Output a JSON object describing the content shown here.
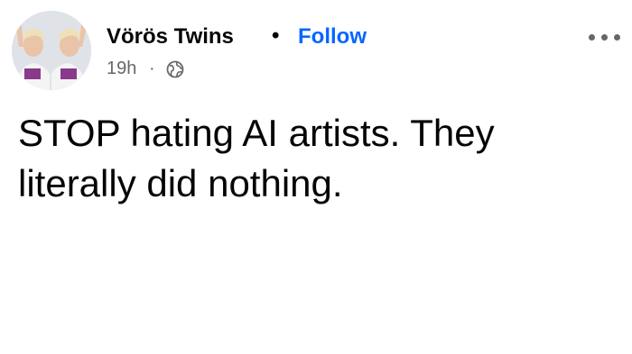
{
  "post": {
    "author": "Vörös Twins",
    "separator": "•",
    "follow_label": "Follow",
    "time": "19h",
    "meta_separator": "·",
    "privacy_icon": "globe-icon",
    "more_icon": "more-options-icon",
    "text": "STOP hating AI artists. They literally did nothing."
  },
  "colors": {
    "follow": "#0866ff",
    "text": "#050505",
    "meta": "#65676b"
  }
}
